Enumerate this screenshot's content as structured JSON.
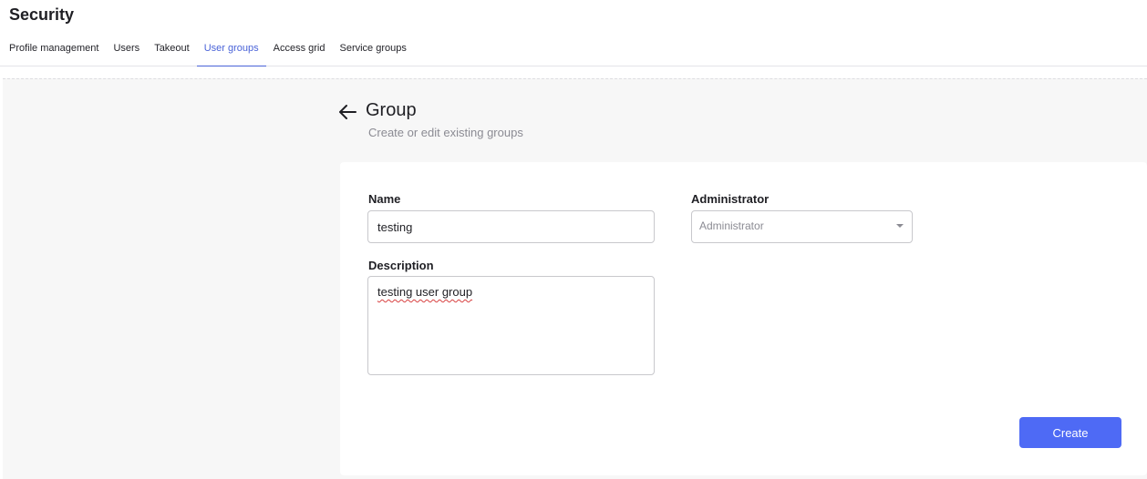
{
  "header": {
    "title": "Security",
    "tabs": [
      {
        "label": "Profile management"
      },
      {
        "label": "Users"
      },
      {
        "label": "Takeout"
      },
      {
        "label": "User groups"
      },
      {
        "label": "Access grid"
      },
      {
        "label": "Service groups"
      }
    ],
    "active_tab": "User groups"
  },
  "group_page": {
    "title": "Group",
    "subtitle": "Create or edit existing groups",
    "back_icon": "arrow-left-icon"
  },
  "form": {
    "name_label": "Name",
    "name_value": "testing",
    "administrator_label": "Administrator",
    "administrator_placeholder": "Administrator",
    "administrator_icon": "chevron-down-icon",
    "description_label": "Description",
    "description_value": "testing user group",
    "create_label": "Create"
  },
  "colors": {
    "accent": "#4a63d8",
    "button": "#4e6af5",
    "background": "#f7f7f7"
  }
}
